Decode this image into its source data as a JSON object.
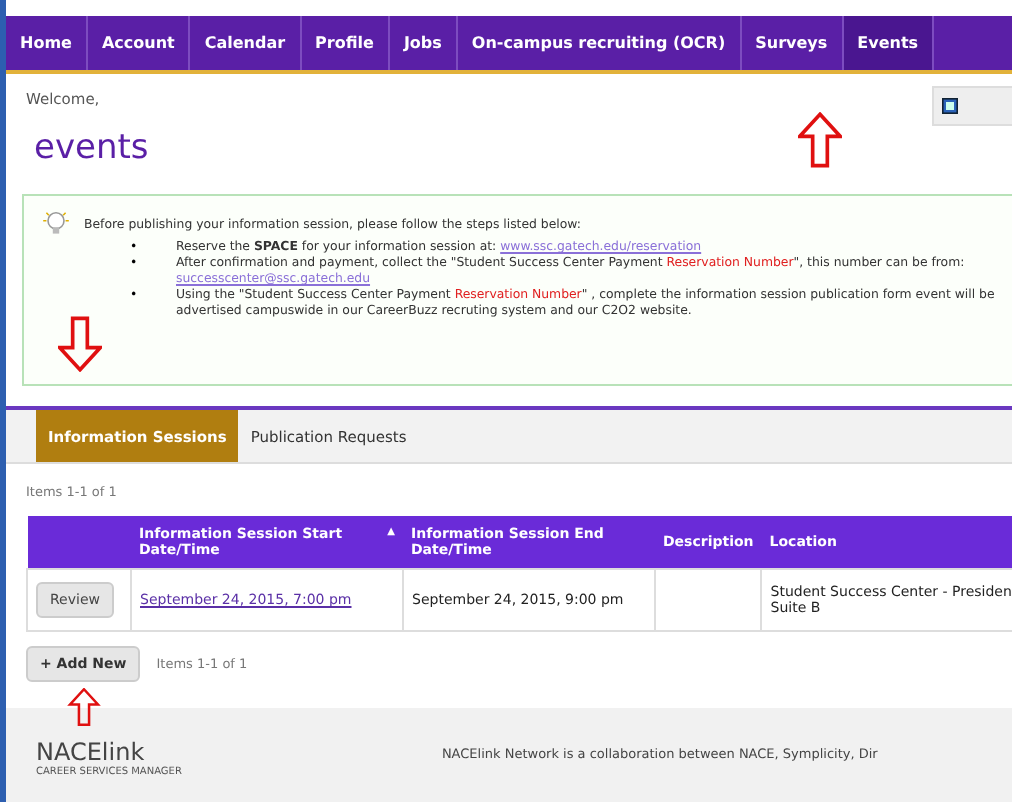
{
  "nav": {
    "items": [
      {
        "label": "Home",
        "selected": false
      },
      {
        "label": "Account",
        "selected": false
      },
      {
        "label": "Calendar",
        "selected": false
      },
      {
        "label": "Profile",
        "selected": false
      },
      {
        "label": "Jobs",
        "selected": false
      },
      {
        "label": "On-campus recruiting (OCR)",
        "selected": false
      },
      {
        "label": "Surveys",
        "selected": false
      },
      {
        "label": "Events",
        "selected": true
      }
    ]
  },
  "welcome": "Welcome,",
  "page_title": "events",
  "notice": {
    "intro": "Before publishing your information session, please follow the steps listed below:",
    "bullet": "•",
    "steps": [
      [
        {
          "kind": "text",
          "text": "Reserve the **SPACE** for your information session at: "
        },
        {
          "kind": "link",
          "text": "www.ssc.gatech.edu/reservation"
        }
      ],
      [
        {
          "kind": "text",
          "text": "After confirmation and payment, collect the \"Student Success Center Payment "
        },
        {
          "kind": "red",
          "text": "Reservation Number"
        },
        {
          "kind": "text",
          "text": "\", this number can be from: "
        },
        {
          "kind": "link",
          "text": "successcenter@ssc.gatech.edu"
        }
      ],
      [
        {
          "kind": "text",
          "text": "Using the \"Student Success Center Payment "
        },
        {
          "kind": "red",
          "text": "Reservation Number"
        },
        {
          "kind": "text",
          "text": "\" , complete the information session publication form event will be advertised campuswide in our CareerBuzz recruting system and our C2O2 website."
        }
      ]
    ]
  },
  "tabs": [
    {
      "label": "Information Sessions",
      "selected": true
    },
    {
      "label": "Publication Requests",
      "selected": false
    }
  ],
  "items_count_top": "Items 1-1 of 1",
  "table": {
    "columns": [
      "Information Session Start Date/Time",
      "Information Session End Date/Time",
      "Description",
      "Location"
    ],
    "sort_indicator": "▲",
    "rows": [
      {
        "action": "Review",
        "start": "September 24, 2015, 7:00 pm",
        "end": "September 24, 2015, 9:00 pm",
        "description": "",
        "location": "Student Success Center - Presiden Suite B"
      }
    ]
  },
  "add_button": "+ Add New",
  "items_count_bottom": "Items 1-1 of 1",
  "footer": {
    "logo": "NACElink",
    "logo_sub": "CAREER SERVICES MANAGER",
    "text": "NACElink Network is a collaboration between NACE, Symplicity, Dir"
  }
}
